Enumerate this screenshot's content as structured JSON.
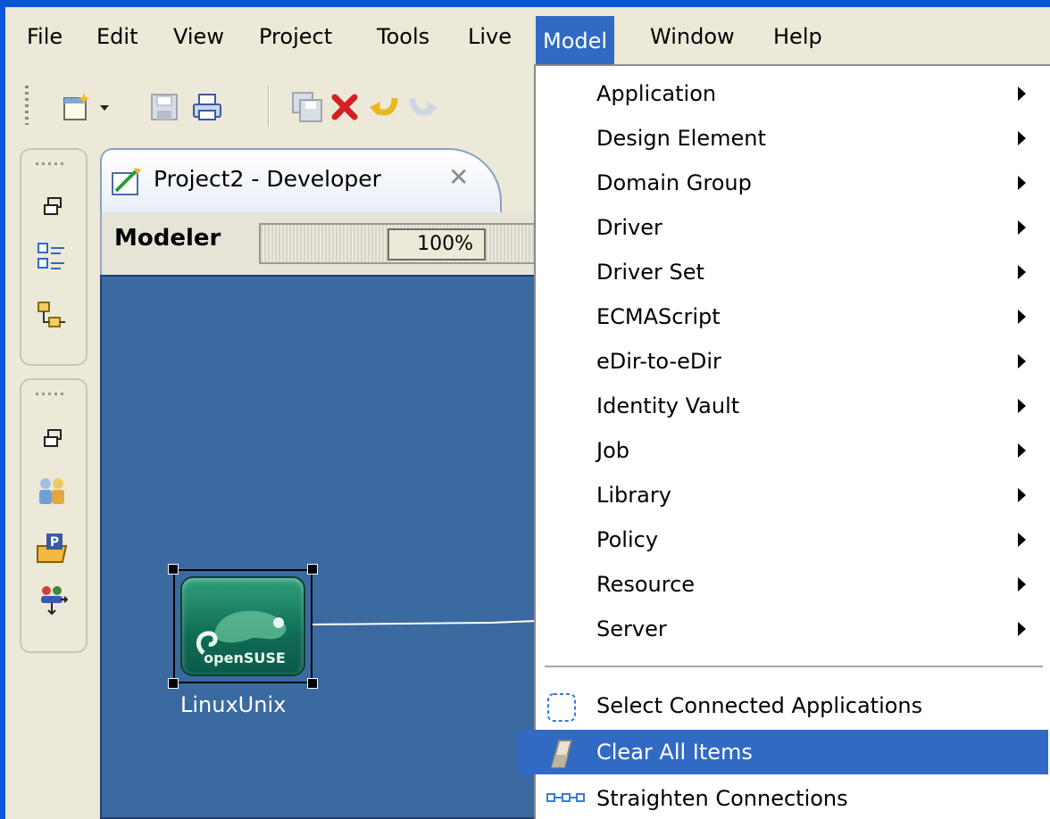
{
  "menubar": {
    "items": [
      "File",
      "Edit",
      "View",
      "Project",
      "Tools",
      "Live",
      "Model",
      "Window",
      "Help"
    ],
    "active": "Model"
  },
  "editor": {
    "tab_title": "Project2 - Developer",
    "modeler_label": "Modeler",
    "zoom": "100%",
    "node_label": "LinuxUnix",
    "node_logo_text": "openSUSE"
  },
  "model_menu": {
    "submenus": [
      "Application",
      "Design Element",
      "Domain Group",
      "Driver",
      "Driver Set",
      "ECMAScript",
      "eDir-to-eDir",
      "Identity Vault",
      "Job",
      "Library",
      "Policy",
      "Resource",
      "Server"
    ],
    "actions": [
      "Select Connected Applications",
      "Clear All Items",
      "Straighten Connections"
    ],
    "highlighted": "Clear All Items"
  },
  "colors": {
    "frame_blue": "#0a58d8",
    "menu_highlight": "#316ac5",
    "canvas_blue": "#3b6aa1",
    "chrome": "#ece9d8"
  }
}
